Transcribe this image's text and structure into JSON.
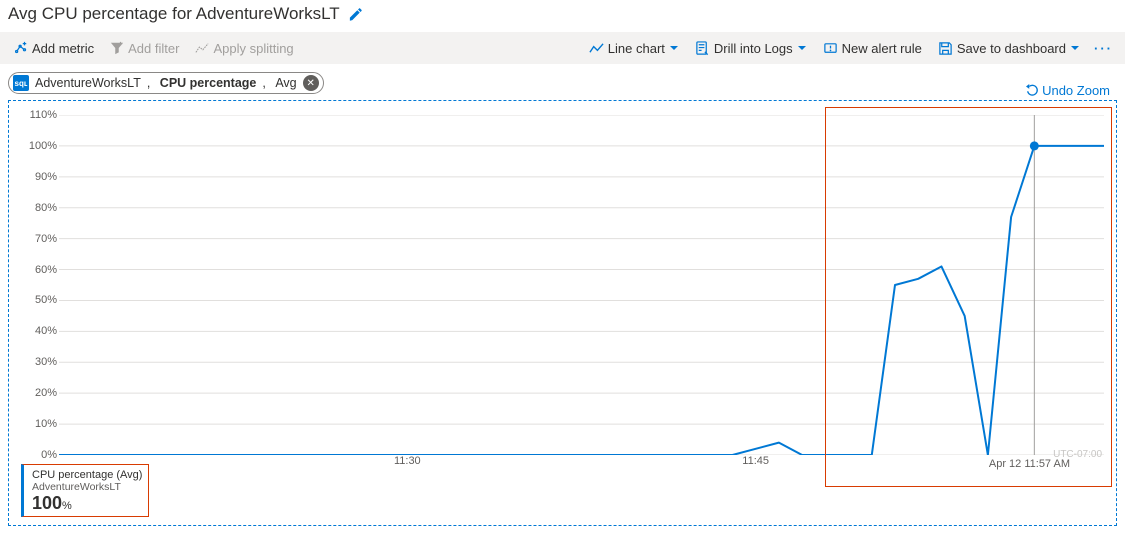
{
  "title": "Avg CPU percentage for AdventureWorksLT",
  "toolbar": {
    "add_metric": "Add metric",
    "add_filter": "Add filter",
    "apply_splitting": "Apply splitting",
    "line_chart": "Line chart",
    "drill_logs": "Drill into Logs",
    "new_alert": "New alert rule",
    "save_dash": "Save to dashboard"
  },
  "pill": {
    "resource": "AdventureWorksLT",
    "metric": "CPU percentage",
    "agg": "Avg"
  },
  "undo_zoom": "Undo Zoom",
  "legend": {
    "name": "CPU percentage (Avg)",
    "resource": "AdventureWorksLT",
    "value": "100",
    "unit": "%"
  },
  "tooltip_time": "Apr 12 11:57 AM",
  "timezone": "UTC-07:00",
  "chart_data": {
    "type": "line",
    "title": "Avg CPU percentage for AdventureWorksLT",
    "ylabel": "%",
    "ylim": [
      0,
      110
    ],
    "yticks": [
      0,
      10,
      20,
      30,
      40,
      50,
      60,
      70,
      80,
      90,
      100,
      110
    ],
    "x_time_labels": [
      "11:30",
      "11:45"
    ],
    "x_time_positions_min": [
      15,
      30
    ],
    "x_range_minutes": [
      0,
      45
    ],
    "series": [
      {
        "name": "CPU percentage (Avg)",
        "color": "#0078d4",
        "points": [
          {
            "x_min": 0,
            "y": 0
          },
          {
            "x_min": 1,
            "y": 0
          },
          {
            "x_min": 2,
            "y": 0
          },
          {
            "x_min": 3,
            "y": 0
          },
          {
            "x_min": 4,
            "y": 0
          },
          {
            "x_min": 5,
            "y": 0
          },
          {
            "x_min": 6,
            "y": 0
          },
          {
            "x_min": 7,
            "y": 0
          },
          {
            "x_min": 8,
            "y": 0
          },
          {
            "x_min": 9,
            "y": 0
          },
          {
            "x_min": 10,
            "y": 0
          },
          {
            "x_min": 11,
            "y": 0
          },
          {
            "x_min": 12,
            "y": 0
          },
          {
            "x_min": 13,
            "y": 0
          },
          {
            "x_min": 14,
            "y": 0
          },
          {
            "x_min": 15,
            "y": 0
          },
          {
            "x_min": 16,
            "y": 0
          },
          {
            "x_min": 17,
            "y": 0
          },
          {
            "x_min": 18,
            "y": 0
          },
          {
            "x_min": 19,
            "y": 0
          },
          {
            "x_min": 20,
            "y": 0
          },
          {
            "x_min": 21,
            "y": 0
          },
          {
            "x_min": 22,
            "y": 0
          },
          {
            "x_min": 23,
            "y": 0
          },
          {
            "x_min": 24,
            "y": 0
          },
          {
            "x_min": 25,
            "y": 0
          },
          {
            "x_min": 26,
            "y": 0
          },
          {
            "x_min": 27,
            "y": 0
          },
          {
            "x_min": 28,
            "y": 0
          },
          {
            "x_min": 29,
            "y": 0
          },
          {
            "x_min": 30,
            "y": 2
          },
          {
            "x_min": 31,
            "y": 4
          },
          {
            "x_min": 32,
            "y": 0
          },
          {
            "x_min": 33,
            "y": 0
          },
          {
            "x_min": 34,
            "y": 0
          },
          {
            "x_min": 35,
            "y": 0
          },
          {
            "x_min": 36,
            "y": 55
          },
          {
            "x_min": 37,
            "y": 57
          },
          {
            "x_min": 38,
            "y": 61
          },
          {
            "x_min": 39,
            "y": 45
          },
          {
            "x_min": 40,
            "y": 0
          },
          {
            "x_min": 41,
            "y": 77
          },
          {
            "x_min": 42,
            "y": 100
          },
          {
            "x_min": 43,
            "y": 100
          },
          {
            "x_min": 44,
            "y": 100
          },
          {
            "x_min": 45,
            "y": 100
          }
        ]
      }
    ],
    "cursor_at_min": 42,
    "marker_at": {
      "x_min": 42,
      "y": 100
    }
  }
}
